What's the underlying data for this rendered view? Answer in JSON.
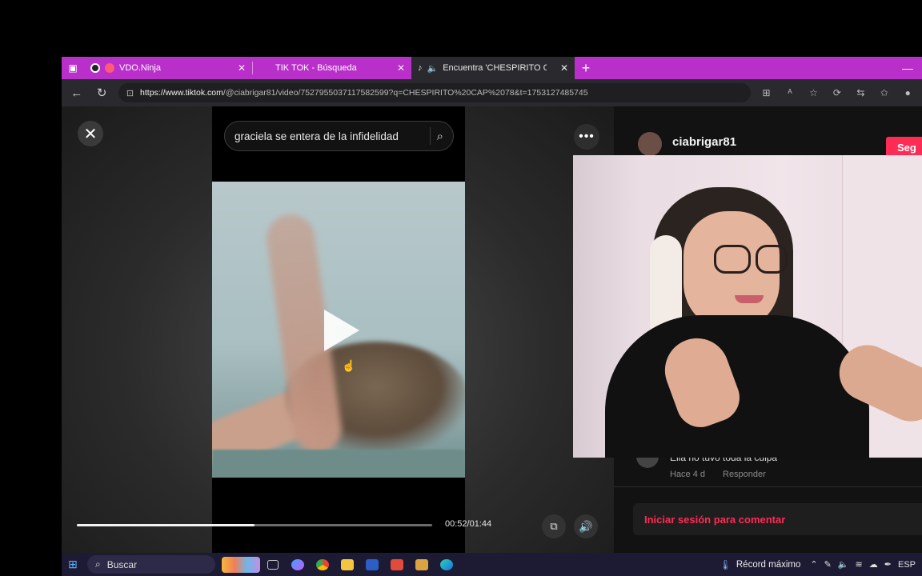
{
  "browser": {
    "tabs": [
      {
        "label": "VDO.Ninja",
        "active": false
      },
      {
        "label": "TIK TOK - Búsqueda",
        "active": false
      },
      {
        "label": "Encuentra 'CHESPIRITO CAP",
        "active": true
      }
    ],
    "new_tab_label": "+",
    "url_host": "https://www.tiktok.com",
    "url_path": "/@ciabrigar81/video/7527955037117582599?q=CHESPIRITO%20CAP%2078&t=1753127485745"
  },
  "tiktok": {
    "search_text": "graciela se entera de la infidelidad",
    "time_readout": "00:52/01:44",
    "progress_fraction": 0.5,
    "more_label": "•••",
    "author": {
      "username": "ciabrigar81",
      "follow_label": "Seg"
    },
    "comment": {
      "text": "Ella no tuvo toda la culpa",
      "time": "Hace 4 d",
      "reply_label": "Responder"
    },
    "login_prompt": "Iniciar sesión para comentar"
  },
  "taskbar": {
    "search_label": "Buscar",
    "weather_label": "Récord máximo",
    "language": "ESP",
    "apps": [
      "task-view",
      "copilot",
      "chrome",
      "file-explorer",
      "word",
      "app-red",
      "app-media",
      "edge"
    ]
  },
  "colors": {
    "tab_bar": "#b92fc9",
    "accent_pink": "#fe2c55",
    "taskbar": "#1d1a33"
  }
}
